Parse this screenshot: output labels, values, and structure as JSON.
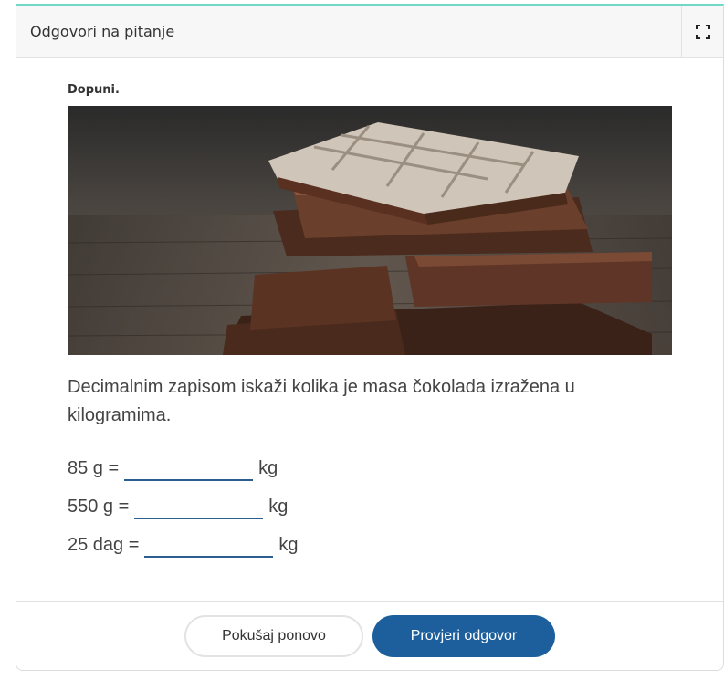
{
  "header": {
    "title": "Odgovori na pitanje",
    "expand_icon": "expand-icon"
  },
  "task": {
    "instruction": "Dopuni.",
    "image_subject": "chocolate-bars-photo",
    "question": "Decimalnim zapisom iskaži kolika je masa čokolada izražena u kilogramima.",
    "rows": [
      {
        "lhs": "85 g =",
        "value": "",
        "unit": "kg"
      },
      {
        "lhs": "550 g =",
        "value": "",
        "unit": "kg"
      },
      {
        "lhs": "25 dag =",
        "value": "",
        "unit": "kg"
      }
    ]
  },
  "footer": {
    "retry_label": "Pokušaj ponovo",
    "check_label": "Provjeri odgovor"
  },
  "colors": {
    "accent_top": "#6fd8c8",
    "primary": "#1d5f9d",
    "underline": "#2c5f8f"
  }
}
